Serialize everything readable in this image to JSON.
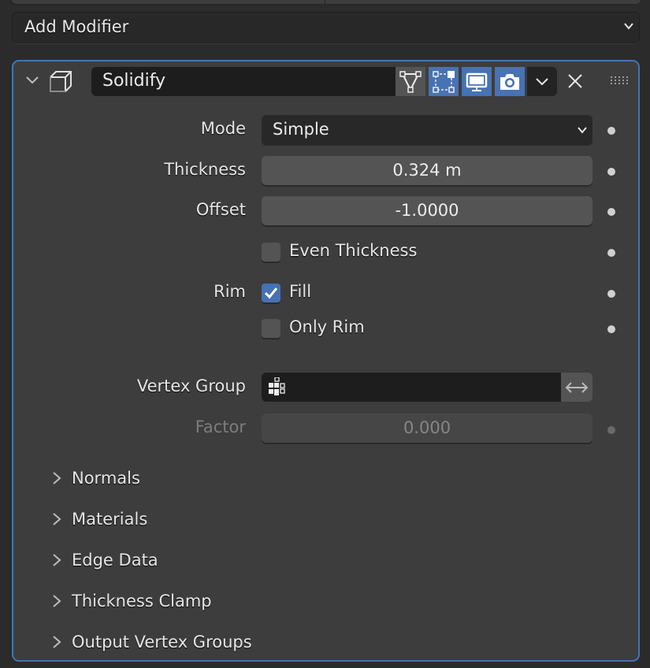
{
  "add_modifier": {
    "label": "Add Modifier",
    "icon": "chevron-down-icon"
  },
  "modifier": {
    "name": "Solidify",
    "type_icon": "solidify-cube-icon",
    "header_buttons": [
      {
        "name": "edit-cage",
        "icon": "vertex-triangle-icon",
        "active": false
      },
      {
        "name": "edit-mode",
        "icon": "edit-mode-square-icon",
        "active": true
      },
      {
        "name": "viewport",
        "icon": "monitor-icon",
        "active": true
      },
      {
        "name": "render",
        "icon": "camera-icon",
        "active": true
      }
    ],
    "accent_color": "#4772b3",
    "properties": {
      "mode": {
        "label": "Mode",
        "value": "Simple"
      },
      "thickness": {
        "label": "Thickness",
        "value": "0.324 m"
      },
      "offset": {
        "label": "Offset",
        "value": "-1.0000"
      },
      "even_thickness": {
        "label": "Even Thickness",
        "checked": false
      },
      "rim_label": "Rim",
      "fill": {
        "label": "Fill",
        "checked": true
      },
      "only_rim": {
        "label": "Only Rim",
        "checked": false
      },
      "vertex_group": {
        "label": "Vertex Group",
        "value": "",
        "invert_icon": "arrows-left-right-icon"
      },
      "factor": {
        "label": "Factor",
        "value": "0.000",
        "enabled": false
      }
    },
    "subpanels": [
      "Normals",
      "Materials",
      "Edge Data",
      "Thickness Clamp",
      "Output Vertex Groups"
    ]
  }
}
